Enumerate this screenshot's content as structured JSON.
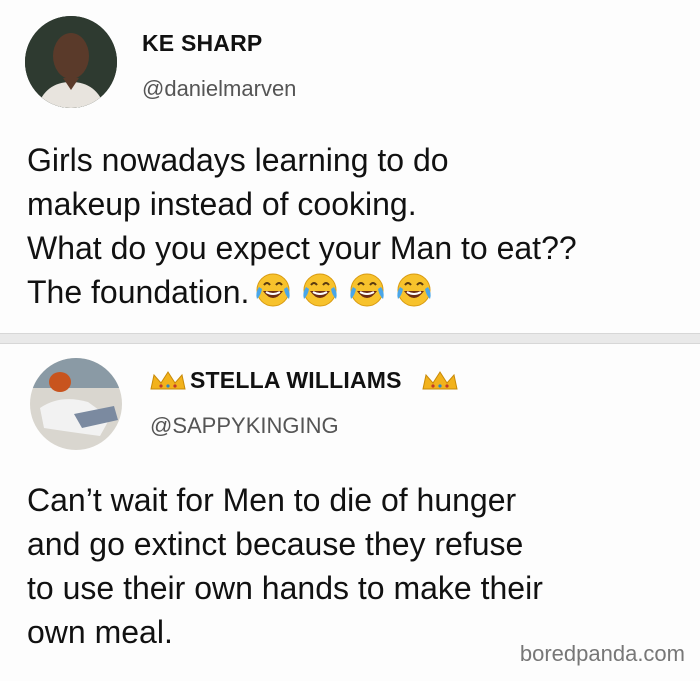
{
  "tweet1": {
    "display_name": "KE SHARP",
    "handle": "@danielmarven",
    "lines": [
      "Girls nowadays learning to do",
      "makeup instead of cooking.",
      "What do you expect your Man to eat??",
      "The foundation."
    ],
    "emoji": "face-with-tears-of-joy-icon",
    "emoji_count": 4
  },
  "tweet2": {
    "display_name": "STELLA WILLIAMS",
    "handle": "@SAPPYKINGING",
    "decoration": "crown-icon",
    "lines": [
      "Can’t wait for Men to die of hunger",
      "and go extinct because they refuse",
      "to use their own hands to make their",
      "own meal."
    ]
  },
  "watermark": "boredpanda.com",
  "colors": {
    "background": "#fdfdfd",
    "divider": "#e9e9e9",
    "handle": "#555555",
    "crown": "#f2b21c",
    "emoji": "#f7c22c"
  }
}
